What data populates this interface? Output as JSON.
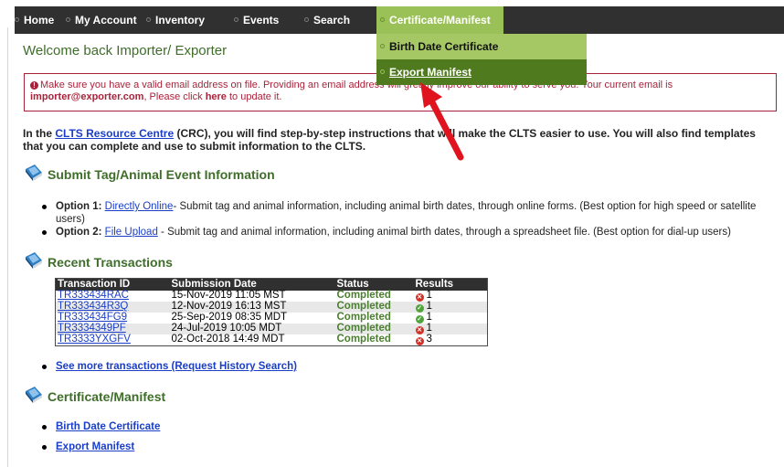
{
  "nav": {
    "items": [
      {
        "label": "Home"
      },
      {
        "label": "My Account"
      },
      {
        "label": "Inventory"
      },
      {
        "label": "Events"
      },
      {
        "label": "Search"
      },
      {
        "label": "Certificate/Manifest"
      }
    ],
    "dropdown": {
      "items": [
        {
          "label": "Birth Date Certificate"
        },
        {
          "label": "Export Manifest"
        }
      ]
    }
  },
  "welcome": "Welcome back  Importer/ Exporter",
  "alert": {
    "text1": "Make sure you have a valid email address on file. Providing an email address will greatly improve our ability to serve you. Your current email is ",
    "email": "importer@exporter.com",
    "text2": ", Please click ",
    "link": "here",
    "text3": " to update it."
  },
  "intro": {
    "prefix": "In the ",
    "link": "CLTS Resource Centre",
    "suffix": " (CRC), you will find step-by-step instructions that will make the CLTS easier to use. You will also find templates that you can complete and use to submit information to the CLTS."
  },
  "sections": {
    "submit": {
      "title": "Submit Tag/Animal Event Information",
      "options": [
        {
          "label": "Option 1:",
          "link": "Directly Online",
          "text": "- Submit tag and animal information, including animal birth dates, through online forms. (Best option for high speed or satellite users)"
        },
        {
          "label": "Option 2:",
          "link": "File Upload",
          "text": " - Submit tag and animal information, including animal birth dates, through a spreadsheet file. (Best option for dial-up users)"
        }
      ]
    },
    "recent": {
      "title": "Recent Transactions",
      "headers": [
        "Transaction ID",
        "Submission Date",
        "Status",
        "Results"
      ],
      "rows": [
        {
          "id": "TR333434RAC",
          "date": "15-Nov-2019 11:05 MST",
          "status": "Completed",
          "result": "1",
          "result_icon": "error-icon"
        },
        {
          "id": "TR333434R3Q",
          "date": "12-Nov-2019 16:13 MST",
          "status": "Completed",
          "result": "1",
          "result_icon": "check-icon"
        },
        {
          "id": "TR333434FG9",
          "date": "25-Sep-2019 08:35 MDT",
          "status": "Completed",
          "result": "1",
          "result_icon": "check-icon"
        },
        {
          "id": "TR3334349PF",
          "date": "24-Jul-2019 10:05 MDT",
          "status": "Completed",
          "result": "1",
          "result_icon": "error-icon"
        },
        {
          "id": "TR3333YXGFV",
          "date": "02-Oct-2018 14:49 MDT",
          "status": "Completed",
          "result": "3",
          "result_icon": "error-icon"
        }
      ],
      "more_link": "See more transactions (Request History Search)"
    },
    "certificate": {
      "title": "Certificate/Manifest",
      "links": [
        "Birth Date Certificate",
        "Export Manifest"
      ]
    }
  },
  "colors": {
    "nav_bg": "#303030",
    "menu_active": "#9ac157",
    "menu_hover": "#4f7b1e",
    "heading_green": "#3f6e2a",
    "alert_red": "#a8233a",
    "link_blue": "#1a3ec8",
    "arrow_red": "#e0141e"
  }
}
